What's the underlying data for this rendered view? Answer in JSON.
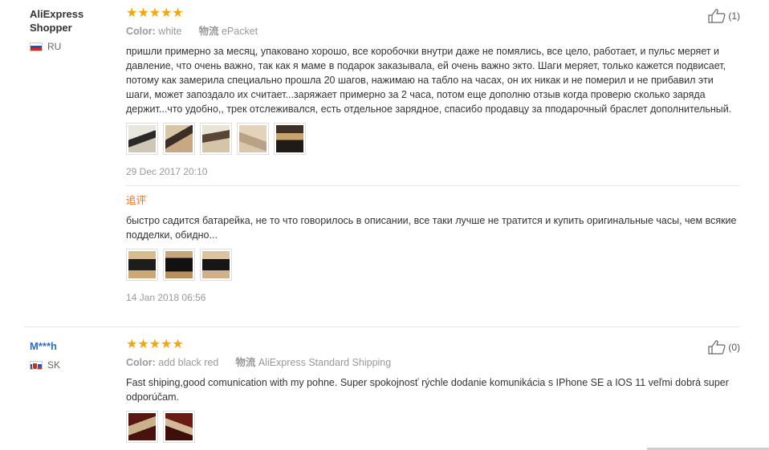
{
  "reviews": [
    {
      "user": {
        "name": "AliExpress Shopper",
        "country": "RU"
      },
      "rating_stars": "★★★★★",
      "rating": 5,
      "color_label": "Color:",
      "color_value": "white",
      "shipping_label": "物流",
      "shipping_value": "ePacket",
      "text": "пришли примерно за месяц, упаковано хорошо, все коробочки внутри даже не помялись, все цело, работает, и пульс меряет и давление, что очень важно, так как я маме в подарок заказывала, ей очень важно экто. Шаги меряет, только кажется подвисает, потому как замерила специально прошла 20 шагов, нажимаю на табло на часах, он их никак и не померил и не прибавил эти шаги, может запоздало их считает...заряжает примерно за 2 часа, потом еще дополню отзыв когда проверю сколько заряда держит...что удобно,, трек отслеживался, есть отдельное зарядное, спасибо продавцу за пподарочный браслет дополнительный.",
      "photo_count": 5,
      "date": "29 Dec 2017 20:10",
      "helpful_count": "(1)",
      "followup": {
        "label": "追评",
        "text": "быстро садится батарейка, не то что говорилось в описании, все таки лучше не тратится и купить оригинальные часы, чем всякие подделки, обидно...",
        "photo_count": 3,
        "date": "14 Jan 2018 06:56"
      }
    },
    {
      "user": {
        "name": "M***h",
        "country": "SK"
      },
      "rating_stars": "★★★★★",
      "rating": 5,
      "color_label": "Color:",
      "color_value": "add black red",
      "shipping_label": "物流",
      "shipping_value": "AliExpress Standard Shipping",
      "text": "Fast shiping,good comunication with my pohne. Super spokojnosť rýchle dodanie komunikácia s IPhone SE a IOS 11 veľmi dobrá super odporúčam.",
      "photo_count": 2,
      "helpful_count": "(0)"
    }
  ],
  "colors": {
    "star": "#f6a509",
    "followup_label": "#f76b1c",
    "masked_name": "#2d6fc4"
  },
  "icons": {
    "helpful": "thumbs-up-icon"
  }
}
